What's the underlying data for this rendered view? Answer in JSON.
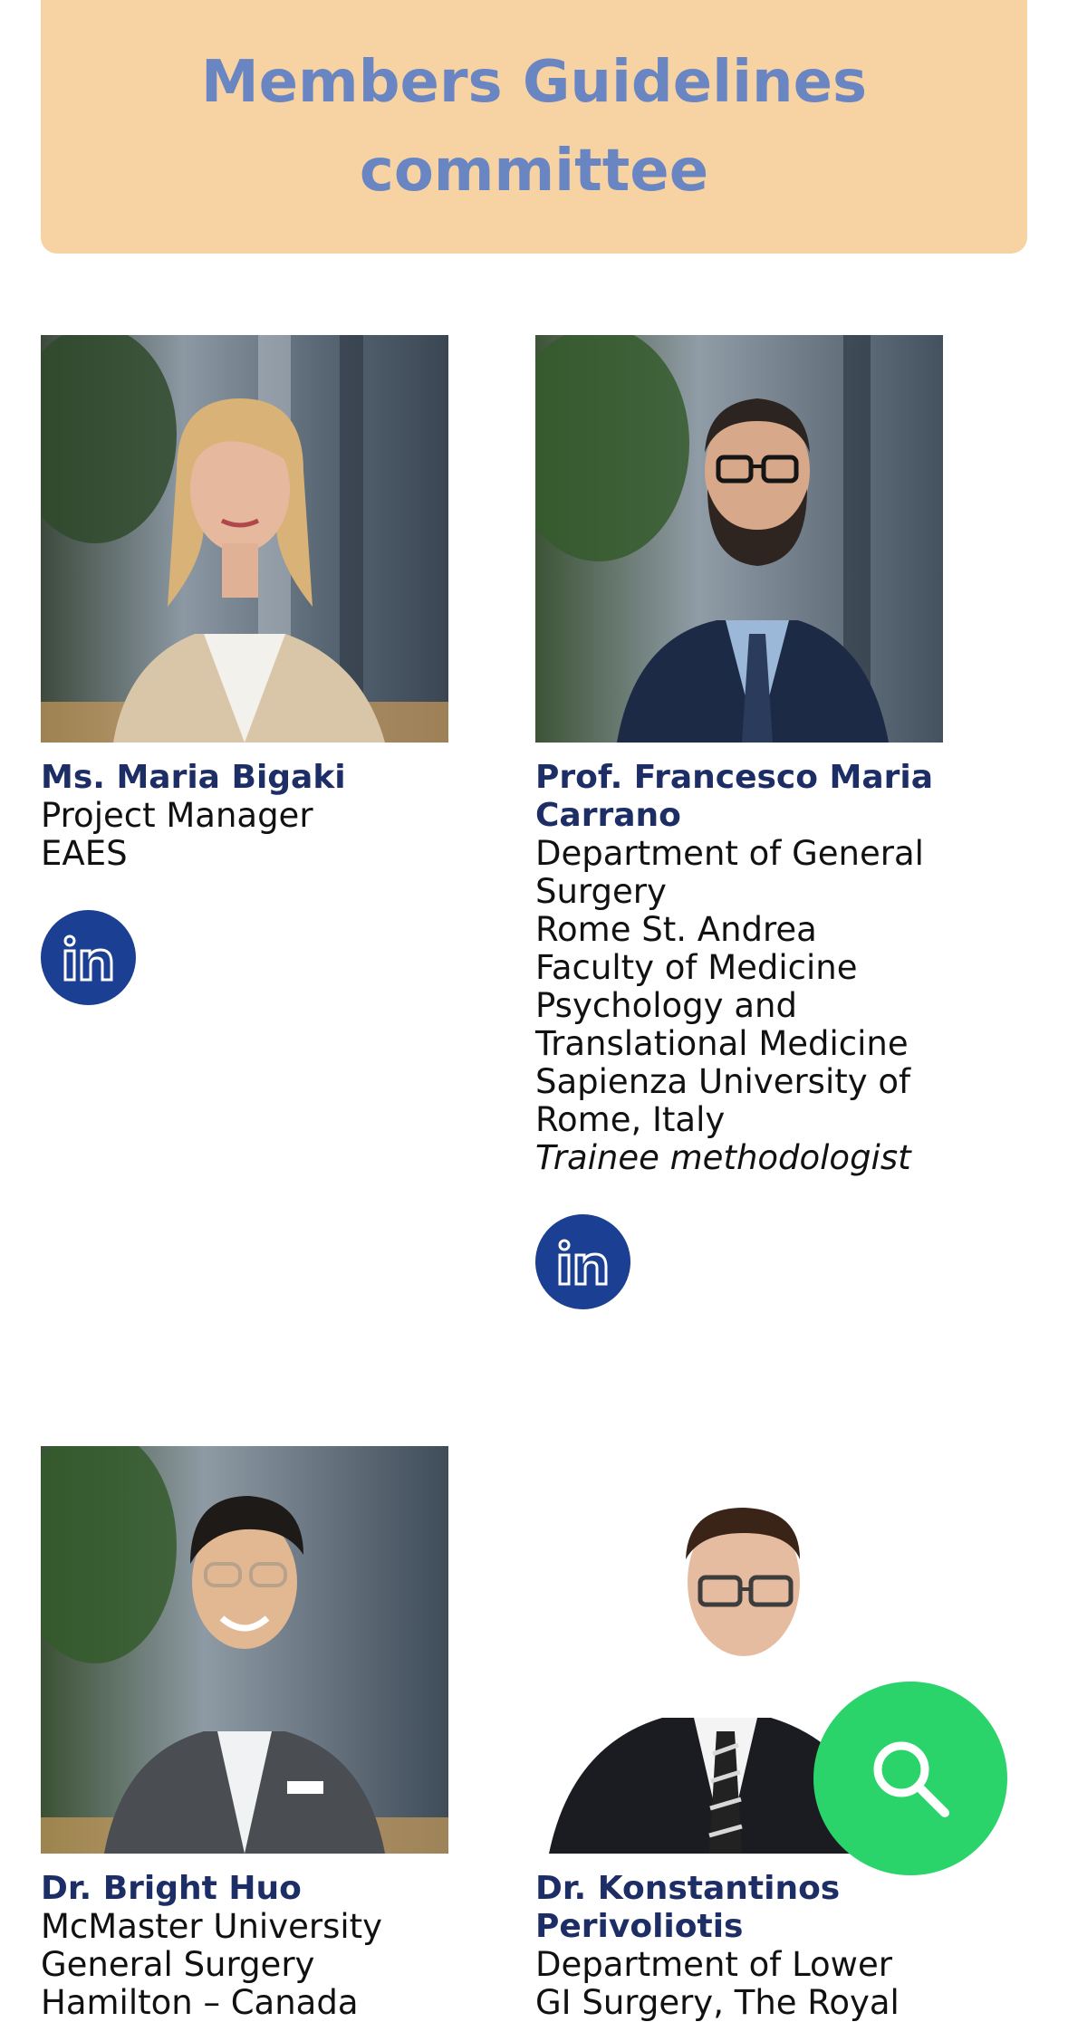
{
  "section": {
    "title_line1": "Members Guidelines",
    "title_line2": "committee"
  },
  "members": [
    {
      "name": "Ms. Maria Bigaki",
      "details": [
        "Project Manager",
        "EAES"
      ]
    },
    {
      "name_line1": "Prof. Francesco Maria",
      "name_line2": "Carrano",
      "details": [
        "Department of General",
        "Surgery",
        "Rome St. Andrea",
        "Faculty of Medicine",
        "Psychology and",
        "Translational Medicine",
        "Sapienza University of",
        "Rome, Italy"
      ],
      "role": "Trainee methodologist"
    },
    {
      "name": "Dr. Bright Huo",
      "details": [
        "McMaster University",
        "General Surgery",
        "Hamilton – Canada"
      ]
    },
    {
      "name_line1": "Dr. Konstantinos",
      "name_line2": "Perivoliotis",
      "details": [
        "Department of Lower",
        "GI Surgery, The Royal"
      ]
    }
  ],
  "icons": {
    "linkedin": "linkedin-icon",
    "search": "search-icon"
  },
  "colors": {
    "banner_bg": "#f7d2a3",
    "banner_title": "#6a86c2",
    "name_text": "#1d2d66",
    "linkedin_bg": "#1b3f93",
    "search_fab": "#2bd46a"
  }
}
